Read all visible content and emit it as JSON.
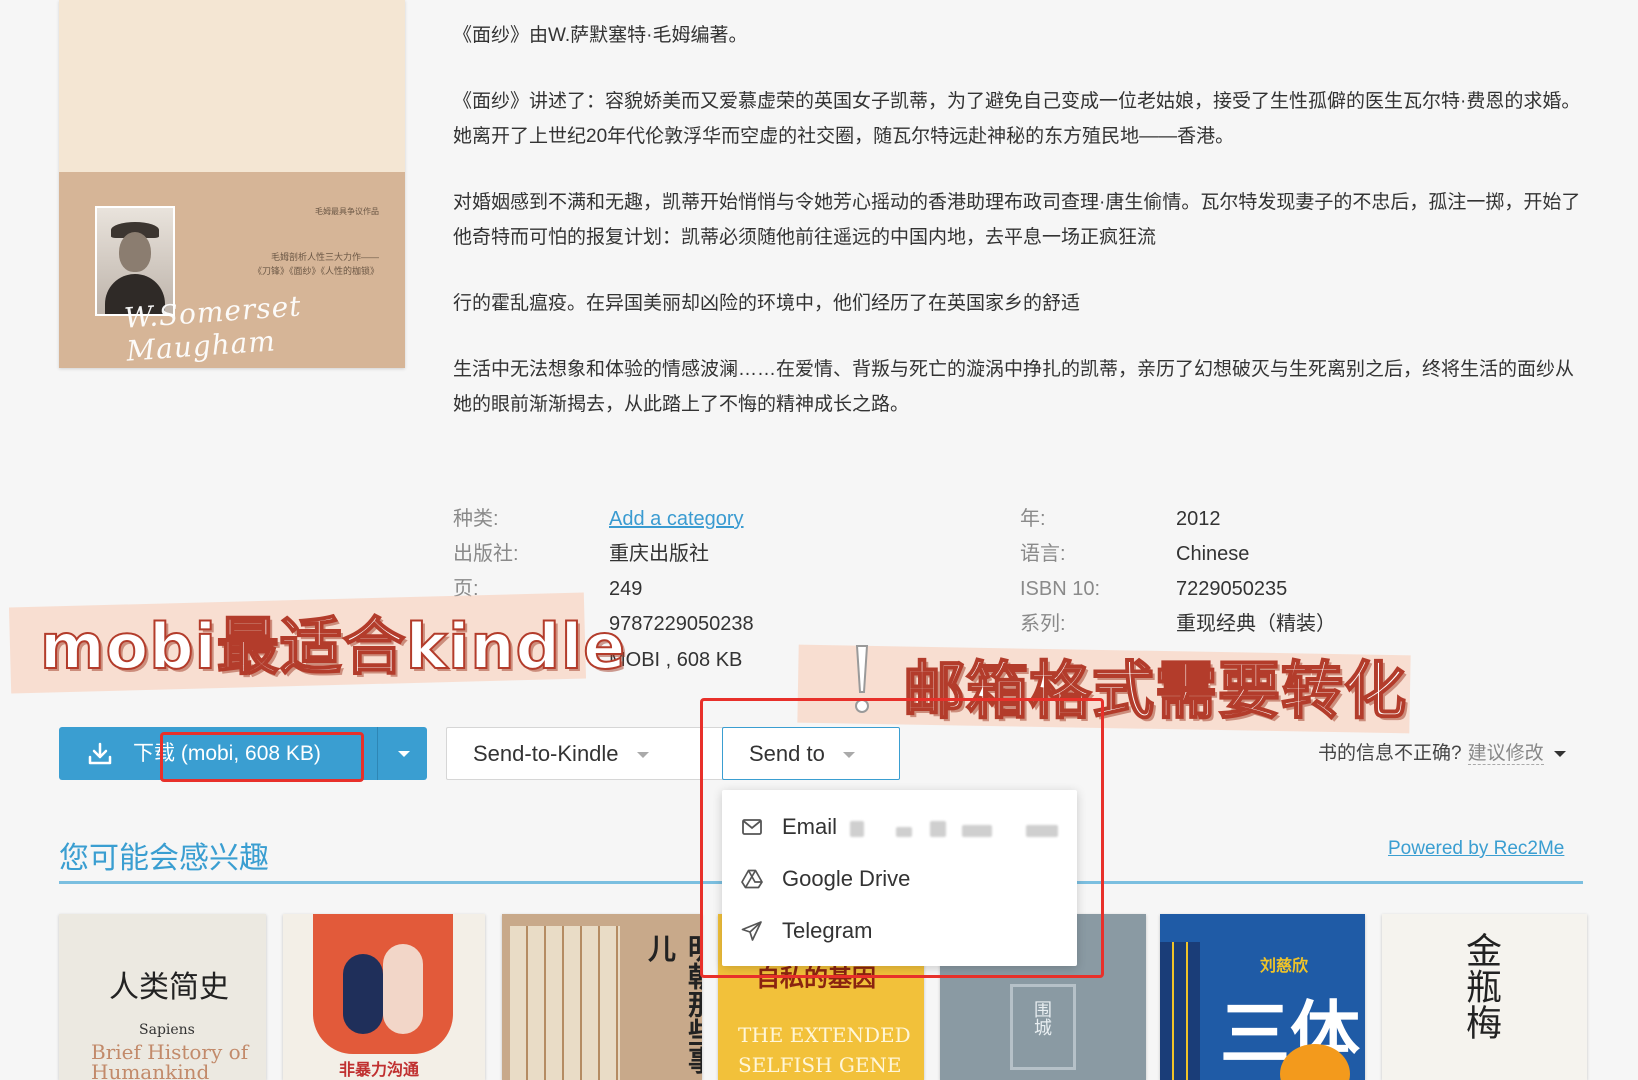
{
  "book": {
    "description": [
      "《面纱》由W.萨默塞特·毛姆编著。",
      "《面纱》讲述了：容貌娇美而又爱慕虚荣的英国女子凯蒂，为了避免自己变成一位老姑娘，接受了生性孤僻的医生瓦尔特·费恩的求婚。她离开了上世纪20年代伦敦浮华而空虚的社交圈，随瓦尔特远赴神秘的东方殖民地——香港。",
      "对婚姻感到不满和无趣，凯蒂开始悄悄与令她芳心摇动的香港助理布政司查理·唐生偷情。瓦尔特发现妻子的不忠后，孤注一掷，开始了他奇特而可怕的报复计划：凯蒂必须随他前往遥远的中国内地，去平息一场正疯狂流",
      "行的霍乱瘟疫。在异国美丽却凶险的环境中，他们经历了在英国家乡的舒适",
      "生活中无法想象和体验的情感波澜……在爱情、背叛与死亡的漩涡中挣扎的凯蒂，亲历了幻想破灭与生死离别之后，终将生活的面纱从她的眼前渐渐揭去，从此踏上了不悔的精神成长之路。"
    ],
    "cover": {
      "text_a": "毛姆最具争议作品",
      "text_b1": "毛姆剖析人性三大力作——",
      "text_b2": "《刀锋》《面纱》《人性的枷锁》",
      "signature": "W.Somerset Maugham"
    }
  },
  "details": {
    "category_label": "种类:",
    "category_value": "Add a category",
    "publisher_label": "出版社:",
    "publisher_value": "重庆出版社",
    "pages_label": "页:",
    "pages_value": "249",
    "isbn13_value": "9787229050238",
    "file_value": "MOBI , 608 KB",
    "year_label": "年:",
    "year_value": "2012",
    "language_label": "语言:",
    "language_value": "Chinese",
    "isbn10_label": "ISBN 10:",
    "isbn10_value": "7229050235",
    "series_label": "系列:",
    "series_value": "重现经典（精装）"
  },
  "actions": {
    "download_label": "下载 (mobi, 608 KB)",
    "send_to_kindle_label": "Send-to-Kindle",
    "send_to_label": "Send to",
    "wrong_info_label": "书的信息不正确?",
    "suggest_label": "建议修改"
  },
  "dropdown": {
    "items": [
      {
        "label": "Email",
        "icon": "mail-icon"
      },
      {
        "label": "Google Drive",
        "icon": "google-drive-icon"
      },
      {
        "label": "Telegram",
        "icon": "telegram-icon"
      }
    ]
  },
  "recommendations": {
    "title": "您可能会感兴趣",
    "powered_by": "Powered by Rec2Me",
    "books": [
      {
        "title": "人类简史",
        "subtitle": "Sapiens",
        "subtitle2": "Brief History of Humankind"
      },
      {
        "title": "非暴力沟通"
      },
      {
        "title": "明朝那些事儿"
      },
      {
        "title": "自私的基因",
        "subtitle": "THE EXTENDED SELFISH GENE"
      },
      {
        "title": "围城"
      },
      {
        "title": "三体",
        "author": "刘慈欣"
      },
      {
        "title": "金瓶梅"
      }
    ]
  },
  "annotations": {
    "sticker_left": "mobi最适合kindle",
    "sticker_right": "邮箱格式需要转化"
  },
  "colors": {
    "accent": "#3a9ed1",
    "annotation_red": "#e8302a"
  }
}
